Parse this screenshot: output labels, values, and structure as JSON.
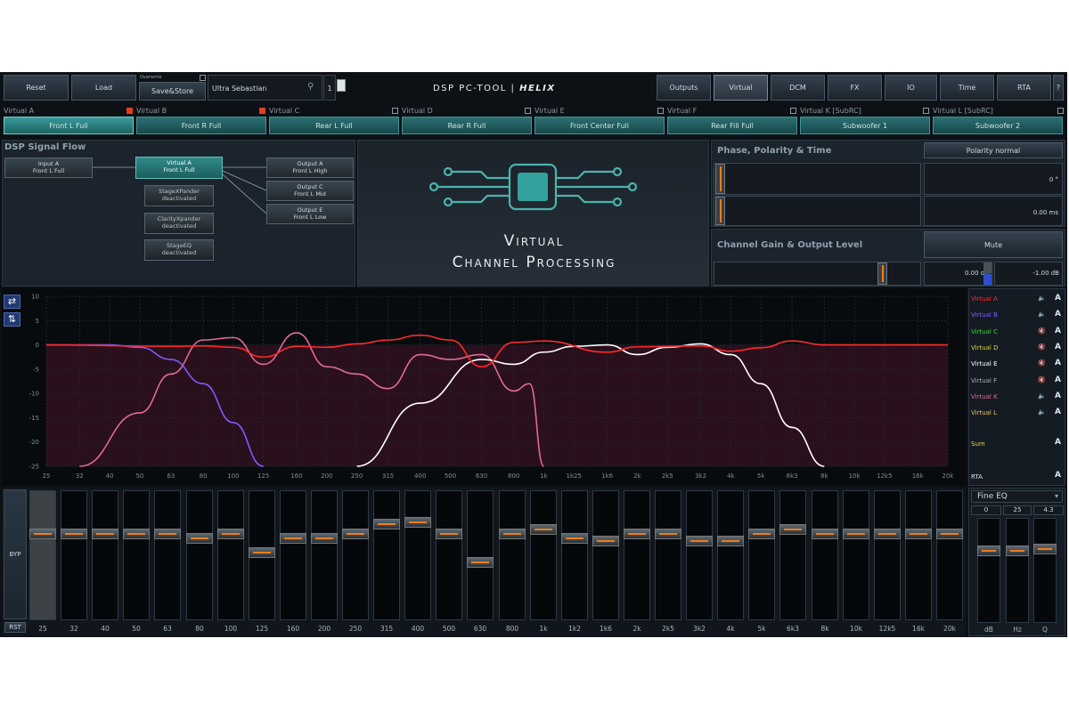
{
  "toolbar": {
    "reset": "Reset",
    "load": "Load",
    "overwrite": "Overwrite",
    "store": "Save&Store",
    "preset_name": "Ultra Sebastian",
    "preset_number": "1",
    "logo_text": "DSP PC-TOOL | ",
    "brand": "HELIX",
    "tabs": [
      "Outputs",
      "Virtual",
      "DCM",
      "FX",
      "IO",
      "Time",
      "RTA",
      "?"
    ],
    "active_tab": "Virtual"
  },
  "channels": [
    {
      "label": "Virtual A",
      "button": "Front L Full",
      "checked": false
    },
    {
      "label": "Virtual B",
      "button": "Front R Full",
      "checked": true
    },
    {
      "label": "Virtual C",
      "button": "Rear L Full",
      "checked": true
    },
    {
      "label": "Virtual D",
      "button": "Rear R Full",
      "checked": false
    },
    {
      "label": "Virtual E",
      "button": "Front Center Full",
      "checked": false
    },
    {
      "label": "Virtual F",
      "button": "Rear Fill Full",
      "checked": false
    },
    {
      "label": "Virtual K [SubRC]",
      "button": "Subwoofer 1",
      "checked": false
    },
    {
      "label": "Virtual L [SubRC]",
      "button": "Subwoofer 2",
      "checked": false
    }
  ],
  "signal_flow": {
    "title": "DSP Signal Flow",
    "input": {
      "line1": "Input A",
      "line2": "Front L Full"
    },
    "virtual": {
      "line1": "Virtual A",
      "line2": "Front L Full"
    },
    "outputs": [
      {
        "line1": "Output A",
        "line2": "Front L High"
      },
      {
        "line1": "Output C",
        "line2": "Front L Mid"
      },
      {
        "line1": "Output E",
        "line2": "Front L Low"
      }
    ],
    "effects": [
      {
        "line1": "StageXPander",
        "line2": "deactivated"
      },
      {
        "line1": "ClarityXpander",
        "line2": "deactivated"
      },
      {
        "line1": "StageEQ",
        "line2": "deactivated"
      }
    ]
  },
  "center_title": {
    "line1": "Virtual",
    "line2": "Channel Processing"
  },
  "phase": {
    "title": "Phase, Polarity & Time",
    "polarity_button": "Polarity normal",
    "phase_value": "0 °",
    "time_value": "0.00 ms"
  },
  "gain": {
    "title": "Channel Gain & Output Level",
    "mute_button": "Mute",
    "gain_value": "0.00 dB",
    "output_level": "-1.00 dB"
  },
  "legend": {
    "items": [
      {
        "name": "Virtual A",
        "color": "#ff2a2a"
      },
      {
        "name": "Virtual B",
        "color": "#7c5cff"
      },
      {
        "name": "Virtual C",
        "color": "#3cd63c"
      },
      {
        "name": "Virtual D",
        "color": "#e8d23a"
      },
      {
        "name": "Virtual E",
        "color": "#ffffff"
      },
      {
        "name": "Virtual F",
        "color": "#b0b0b0"
      },
      {
        "name": "Virtual K",
        "color": "#e06a9a"
      },
      {
        "name": "Virtual L",
        "color": "#e8c26a"
      }
    ],
    "sum": "Sum",
    "rta": "RTA",
    "a_label": "A"
  },
  "chart_data": {
    "type": "line",
    "x_ticks": [
      "25",
      "32",
      "40",
      "50",
      "63",
      "80",
      "100",
      "125",
      "160",
      "200",
      "250",
      "315",
      "400",
      "500",
      "630",
      "800",
      "1k",
      "1k25",
      "1k6",
      "2k",
      "2k5",
      "3k2",
      "4k",
      "5k",
      "6k3",
      "8k",
      "10k",
      "12k5",
      "16k",
      "20k"
    ],
    "x_scale": "log",
    "y_ticks": [
      "10",
      "5",
      "0",
      "-5",
      "-10",
      "-15",
      "-20",
      "-25"
    ],
    "ylim": [
      -25,
      10
    ],
    "series": [
      {
        "name": "Virtual A",
        "color": "#ff2a2a",
        "points": [
          [
            25,
            0
          ],
          [
            63,
            -0.3
          ],
          [
            80,
            -0.2
          ],
          [
            100,
            -0.5
          ],
          [
            125,
            -2.5
          ],
          [
            160,
            -0.3
          ],
          [
            200,
            -0.5
          ],
          [
            250,
            0.2
          ],
          [
            315,
            1
          ],
          [
            400,
            2
          ],
          [
            500,
            1
          ],
          [
            630,
            -4.5
          ],
          [
            800,
            0.5
          ],
          [
            1000,
            0.8
          ],
          [
            1600,
            -1.5
          ],
          [
            2000,
            -0.4
          ],
          [
            3200,
            -0.2
          ],
          [
            4000,
            -1.3
          ],
          [
            5000,
            -0.6
          ],
          [
            6300,
            0.8
          ],
          [
            8000,
            0
          ],
          [
            20000,
            0
          ]
        ]
      },
      {
        "name": "Virtual B",
        "color": "#7c5cff",
        "points": [
          [
            25,
            0
          ],
          [
            40,
            0
          ],
          [
            50,
            -0.5
          ],
          [
            63,
            -3
          ],
          [
            80,
            -8
          ],
          [
            100,
            -16
          ],
          [
            125,
            -25
          ]
        ]
      },
      {
        "name": "Virtual K",
        "color": "#e06a9a",
        "points": [
          [
            32,
            -25
          ],
          [
            50,
            -14
          ],
          [
            63,
            -6
          ],
          [
            80,
            1
          ],
          [
            100,
            1.5
          ],
          [
            125,
            -4
          ],
          [
            160,
            2.5
          ],
          [
            200,
            -4.5
          ],
          [
            250,
            -6
          ],
          [
            315,
            -9
          ],
          [
            400,
            -2
          ],
          [
            500,
            -3
          ],
          [
            630,
            -2
          ],
          [
            800,
            -9.5
          ],
          [
            900,
            -8
          ],
          [
            1000,
            -25
          ]
        ]
      },
      {
        "name": "Virtual E",
        "color": "#ffffff",
        "points": [
          [
            250,
            -25
          ],
          [
            400,
            -12
          ],
          [
            630,
            -3
          ],
          [
            800,
            -4
          ],
          [
            1000,
            -1.5
          ],
          [
            1250,
            -0.3
          ],
          [
            1600,
            0
          ],
          [
            2000,
            -2
          ],
          [
            2500,
            -0.5
          ],
          [
            3200,
            0.2
          ],
          [
            4000,
            -2
          ],
          [
            5000,
            -8
          ],
          [
            6300,
            -17
          ],
          [
            8000,
            -25
          ]
        ]
      }
    ]
  },
  "left_tools": {
    "swap": "⇄",
    "flip": "⇅"
  },
  "eq": {
    "byp": "BYP",
    "rst": "RST",
    "bands": [
      "25",
      "32",
      "40",
      "50",
      "63",
      "80",
      "100",
      "125",
      "160",
      "200",
      "250",
      "315",
      "400",
      "500",
      "630",
      "800",
      "1k",
      "1k2",
      "1k6",
      "2k",
      "2k5",
      "3k2",
      "4k",
      "5k",
      "6k3",
      "8k",
      "10k",
      "12k5",
      "16k",
      "20k"
    ],
    "gains": [
      0,
      0,
      0,
      0,
      0,
      -1,
      0,
      -4,
      -1,
      -1,
      0,
      2,
      2.5,
      0,
      -6,
      0,
      1,
      -1,
      -1.5,
      0,
      0,
      -1.5,
      -1.5,
      0,
      1,
      0,
      0,
      0,
      0,
      0
    ],
    "selected_band": "25"
  },
  "fine_eq": {
    "title": "Fine EQ",
    "values": [
      "0",
      "25",
      "4.3"
    ],
    "labels": [
      "dB",
      "Hz",
      "Q"
    ]
  }
}
